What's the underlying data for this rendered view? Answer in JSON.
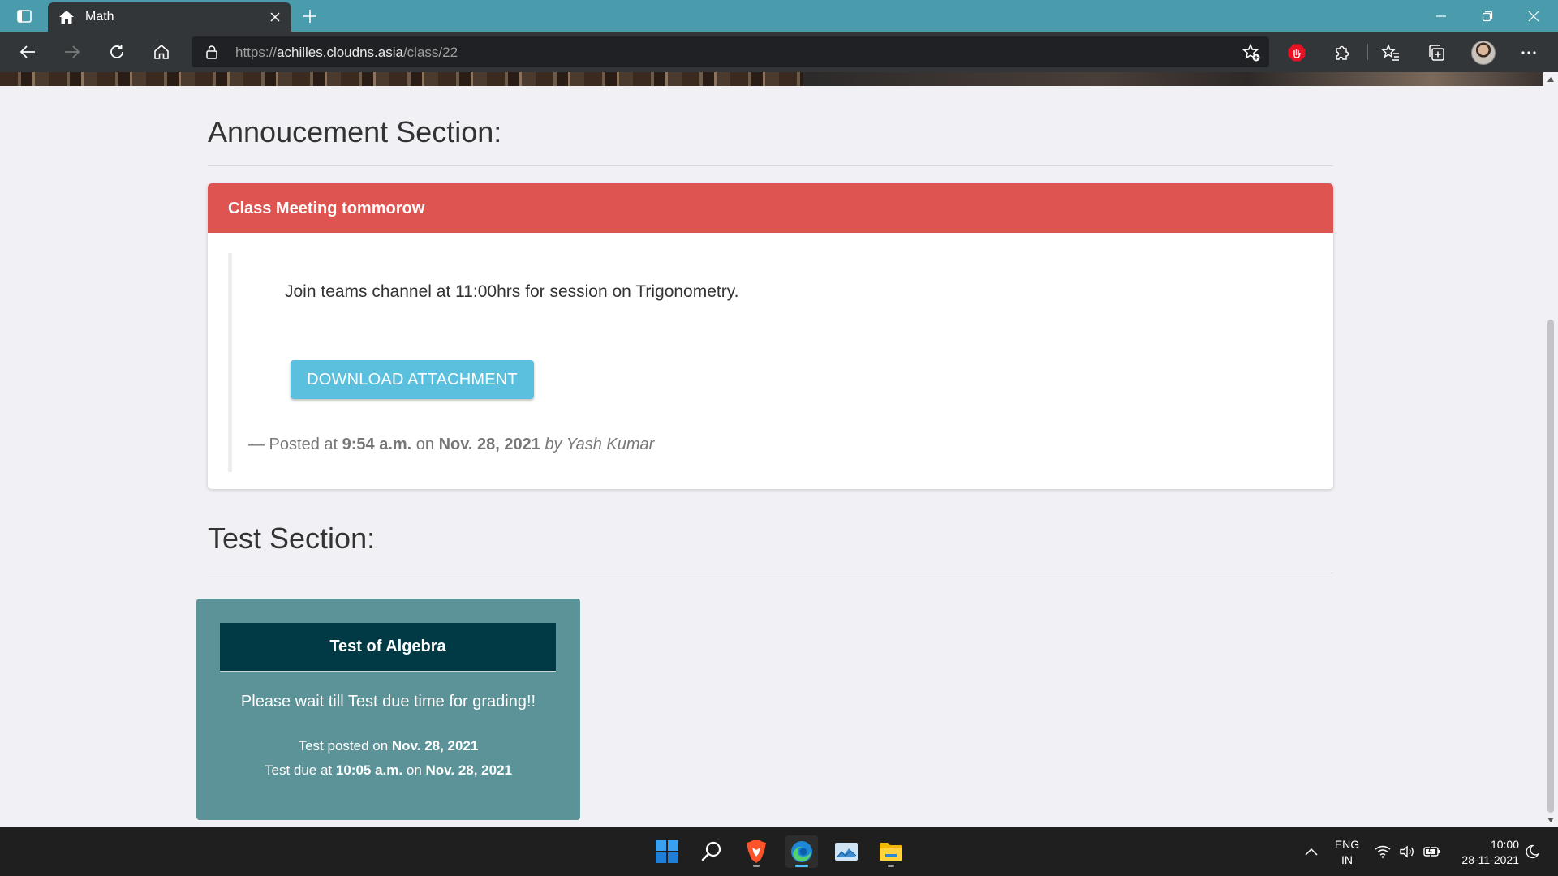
{
  "browser": {
    "tab_title": "Math",
    "url_prefix": "https://",
    "url_host": "achilles.cloudns.asia",
    "url_path": "/class/22",
    "icons": [
      "tab-actions-icon",
      "home-icon",
      "close-icon",
      "plus-icon",
      "minimize-icon",
      "restore-icon",
      "back-icon",
      "forward-icon",
      "refresh-icon",
      "lock-icon",
      "add-favorite-icon",
      "extension-stop-icon",
      "puzzle-icon",
      "favorites-icon",
      "collections-icon",
      "more-icon"
    ],
    "colors": {
      "titlebar": "#4a9cad",
      "toolbar": "#323639"
    }
  },
  "announcements": {
    "heading": "Annoucement Section:",
    "items": [
      {
        "title": "Class Meeting tommorow",
        "body": "Join teams channel at 11:00hrs for session on Trigonometry.",
        "button_label": "DOWNLOAD ATTACHMENT",
        "footer_prefix": "— Posted at",
        "footer_time": "9:54 a.m.",
        "footer_on": "on",
        "footer_date": "Nov. 28, 2021",
        "footer_by": "by Yash Kumar"
      }
    ],
    "colors": {
      "header": "#de5450",
      "button": "#5bc0de"
    }
  },
  "tests": {
    "heading": "Test Section:",
    "items": [
      {
        "title": "Test of Algebra",
        "message": "Please wait till Test due time for grading!!",
        "posted_prefix": "Test posted on",
        "posted_date": "Nov. 28, 2021",
        "due_prefix": "Test due at",
        "due_time": "10:05 a.m.",
        "due_on": "on",
        "due_date": "Nov. 28, 2021"
      }
    ],
    "colors": {
      "card": "#5b9399",
      "header": "#013a44"
    }
  },
  "taskbar": {
    "apps": [
      "windows-start-icon",
      "search-icon",
      "brave-browser-icon",
      "edge-browser-icon",
      "photos-icon",
      "file-explorer-icon"
    ],
    "lang_line1": "ENG",
    "lang_line2": "IN",
    "time": "10:00",
    "date": "28-11-2021"
  }
}
